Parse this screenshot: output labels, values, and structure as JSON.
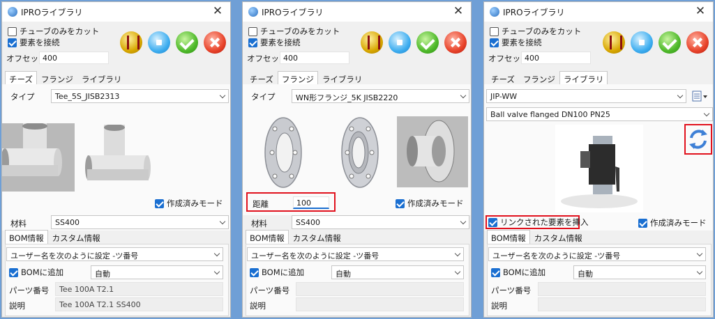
{
  "common": {
    "window_title": "IPROライブラリ",
    "close_glyph": "✕",
    "cut_tube_only": "チューブのみをカット",
    "connect_elements": "要素を接続",
    "offset_label": "オフセット",
    "offset_value": "400",
    "tabs": [
      "チーズ",
      "フランジ",
      "ライブラリ"
    ],
    "built_mode": "作成済みモード",
    "bom_tabs": [
      "BOM情報",
      "カスタム情報"
    ],
    "user_name_setting": "ユーザー名を次のように設定 -ツ番号",
    "bom_add": "BOMに追加",
    "bom_add_value": "自動",
    "part_number_label": "パーツ番号",
    "description_label": "説明",
    "type_label": "タイプ",
    "material_label": "材料",
    "material_value": "SS400"
  },
  "icons": {
    "window": "ipro-globe-icon",
    "tool1": "pipe-tee-tool-icon",
    "tool2": "stop-icon",
    "tool3": "ok-check-icon",
    "tool4": "cancel-x-icon",
    "refresh": "refresh-icon",
    "library_menu": "library-list-icon"
  },
  "colors": {
    "highlight": "#e1111d",
    "checkbox_accent": "#1a6fd1",
    "background": "#6f9fd6"
  },
  "p1": {
    "active_tab": "チーズ",
    "type_value": "Tee_5S_JISB2313",
    "part_number_value": "Tee 100A T2.1",
    "description_value": "Tee 100A T2.1 SS400"
  },
  "p2": {
    "active_tab": "フランジ",
    "type_value": "WN形フランジ_5K JISB2220",
    "distance_label": "距離",
    "distance_value": "100"
  },
  "p3": {
    "active_tab": "ライブラリ",
    "library_value": "JIP-WW",
    "component_value": "Ball valve flanged DN100 PN25",
    "insert_linked": "リンクされた要素を挿入"
  }
}
